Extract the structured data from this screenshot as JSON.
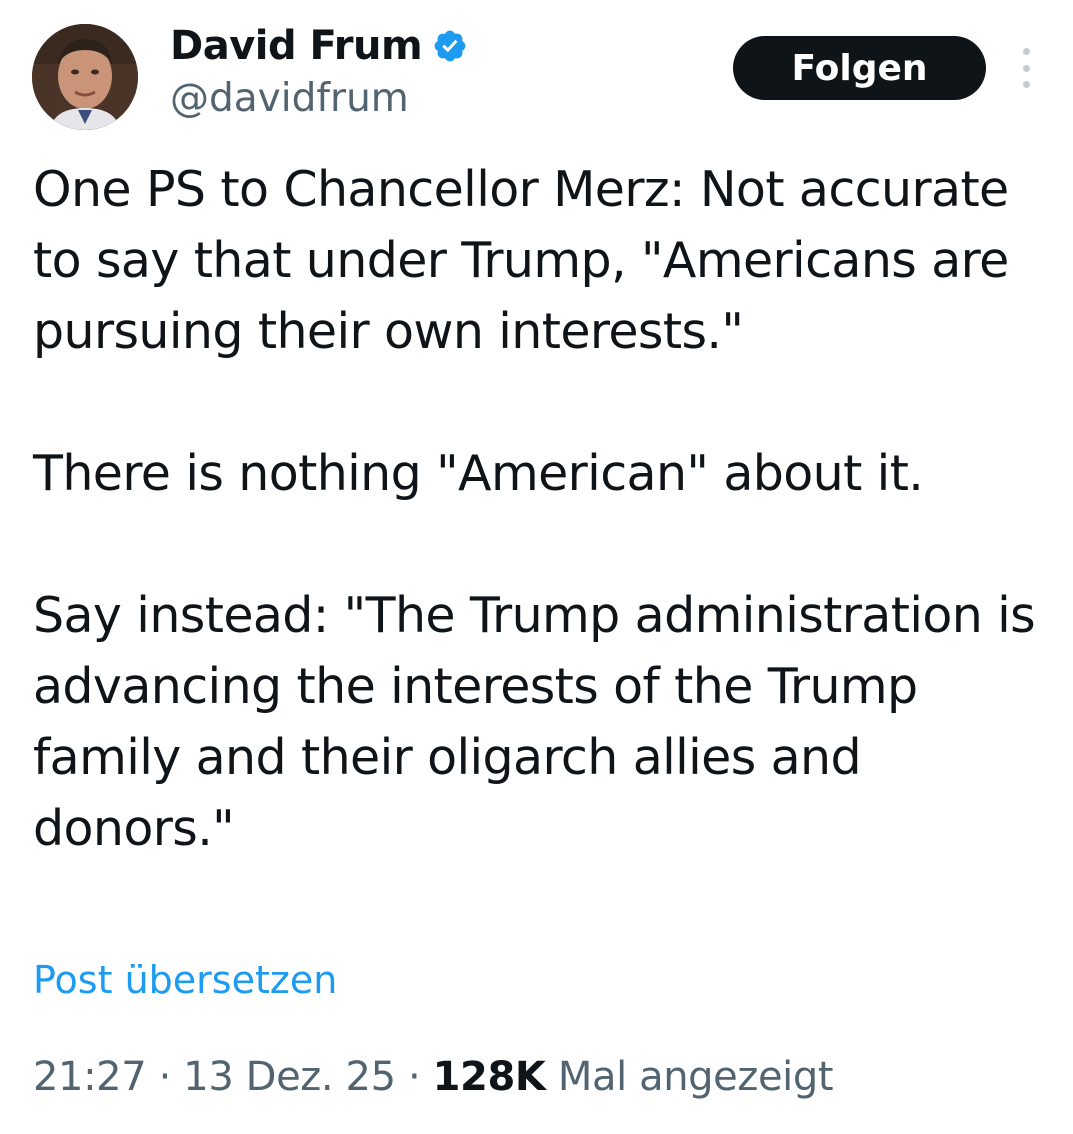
{
  "author": {
    "display_name": "David Frum",
    "handle": "@davidfrum",
    "verified": true,
    "avatar_icon": "profile-photo"
  },
  "actions": {
    "follow_label": "Folgen",
    "more_icon": "more-options-icon"
  },
  "tweet": {
    "paragraphs": [
      "One PS to Chancellor Merz: Not accurate to say that under Trump, \"Americans are pursuing their own interests.\"",
      "There is nothing \"American\" about it.",
      "Say instead: \"The Trump administration is advancing the interests of the Trump family and their oligarch allies and donors.\""
    ],
    "translate_label": "Post übersetzen"
  },
  "meta": {
    "time": "21:27",
    "separator": "·",
    "date": "13 Dez. 25",
    "views_count": "128K",
    "views_label": "Mal angezeigt"
  },
  "colors": {
    "text_primary": "#0f1419",
    "text_secondary": "#536471",
    "link": "#1d9bf0",
    "verified_badge": "#1d9bf0",
    "button_bg": "#0f1419"
  }
}
